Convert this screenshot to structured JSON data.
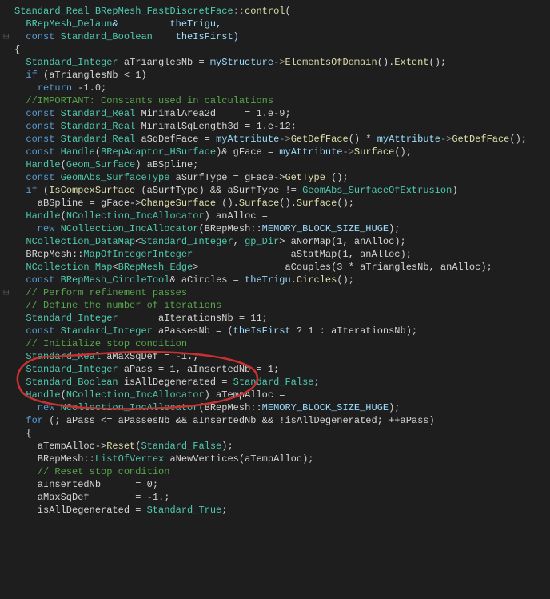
{
  "code": {
    "l01a": "Standard_Real",
    "l01b": " ",
    "l01c": "BRepMesh_FastDiscretFace",
    "l01d": "::",
    "l01e": "control",
    "l01f": "(",
    "l02a": "  ",
    "l02b": "BRepMesh_Delaun",
    "l02c": "&         theTrigu,",
    "l03a": "  ",
    "l03b": "const",
    "l03c": " ",
    "l03d": "Standard_Boolean",
    "l03e": "    theIsFirst)",
    "l04": "{",
    "l05a": "  ",
    "l05b": "Standard_Integer",
    "l05c": " aTrianglesNb = ",
    "l05d": "myStructure",
    "l05e": "->",
    "l05f": "ElementsOfDomain",
    "l05g": "().",
    "l05h": "Extent",
    "l05i": "();",
    "l06a": "  ",
    "l06b": "if",
    "l06c": " (aTrianglesNb < 1)",
    "l07a": "    ",
    "l07b": "return",
    "l07c": " -1.0;",
    "l08": "",
    "l09a": "  ",
    "l09b": "//IMPORTANT: Constants used in calculations",
    "l10a": "  ",
    "l10b": "const",
    "l10c": " ",
    "l10d": "Standard_Real",
    "l10e": " MinimalArea2d     = 1.e-9;",
    "l11a": "  ",
    "l11b": "const",
    "l11c": " ",
    "l11d": "Standard_Real",
    "l11e": " MinimalSqLength3d = 1.e-12;",
    "l12a": "  ",
    "l12b": "const",
    "l12c": " ",
    "l12d": "Standard_Real",
    "l12e": " aSqDefFace = ",
    "l12f": "myAttribute",
    "l12g": "->",
    "l12h": "GetDefFace",
    "l12i": "() * ",
    "l12j": "myAttribute",
    "l12k": "->",
    "l12l": "GetDefFace",
    "l12m": "();",
    "l13": "",
    "l14a": "  ",
    "l14b": "const",
    "l14c": " ",
    "l14d": "Handle",
    "l14e": "(",
    "l14f": "BRepAdaptor_HSurface",
    "l14g": ")& gFace = ",
    "l14h": "myAttribute",
    "l14i": "->",
    "l14j": "Surface",
    "l14k": "();",
    "l15": "",
    "l16a": "  ",
    "l16b": "Handle",
    "l16c": "(",
    "l16d": "Geom_Surface",
    "l16e": ") aBSpline;",
    "l17a": "  ",
    "l17b": "const",
    "l17c": " ",
    "l17d": "GeomAbs_SurfaceType",
    "l17e": " aSurfType = gFace->",
    "l17f": "GetType",
    "l17g": " ();",
    "l18a": "  ",
    "l18b": "if",
    "l18c": " (",
    "l18d": "IsCompexSurface",
    "l18e": " (aSurfType) && aSurfType != ",
    "l18f": "GeomAbs_SurfaceOfExtrusion",
    "l18g": ")",
    "l19a": "    aBSpline = gFace->",
    "l19b": "ChangeSurface",
    "l19c": " ().",
    "l19d": "Surface",
    "l19e": "().",
    "l19f": "Surface",
    "l19g": "();",
    "l20": "",
    "l21a": "  ",
    "l21b": "Handle",
    "l21c": "(",
    "l21d": "NCollection_IncAllocator",
    "l21e": ") anAlloc =",
    "l22a": "    ",
    "l22b": "new",
    "l22c": " ",
    "l22d": "NCollection_IncAllocator",
    "l22e": "(BRepMesh::",
    "l22f": "MEMORY_BLOCK_SIZE_HUGE",
    "l22g": ");",
    "l23a": "  ",
    "l23b": "NCollection_DataMap",
    "l23c": "<",
    "l23d": "Standard_Integer",
    "l23e": ", ",
    "l23f": "gp_Dir",
    "l23g": "> aNorMap(1, anAlloc);",
    "l24a": "  BRepMesh::",
    "l24b": "MapOfIntegerInteger",
    "l24c": "                 aStatMap(1, anAlloc);",
    "l25a": "  ",
    "l25b": "NCollection_Map",
    "l25c": "<",
    "l25d": "BRepMesh_Edge",
    "l25e": ">               aCouples(3 * aTrianglesNb, anAlloc);",
    "l26a": "  ",
    "l26b": "const",
    "l26c": " ",
    "l26d": "BRepMesh_CircleTool",
    "l26e": "& aCircles = ",
    "l26f": "theTrigu",
    "l26g": ".",
    "l26h": "Circles",
    "l26i": "();",
    "l27": "",
    "l28a": "  ",
    "l28b": "// Perform refinement passes",
    "l29a": "  ",
    "l29b": "// Define the number of iterations",
    "l30a": "  ",
    "l30b": "Standard_Integer",
    "l30c": "       aIterationsNb = 11;",
    "l31a": "  ",
    "l31b": "const",
    "l31c": " ",
    "l31d": "Standard_Integer",
    "l31e": " aPassesNb = (",
    "l31f": "theIsFirst",
    "l31g": " ? 1 : aIterationsNb);",
    "l32a": "  ",
    "l32b": "// Initialize stop condition",
    "l33a": "  ",
    "l33b": "Standard_Real",
    "l33c": " aMaxSqDef = -1.;",
    "l34a": "  ",
    "l34b": "Standard_Integer",
    "l34c": " aPass = 1, aInsertedNb = 1;",
    "l35a": "  ",
    "l35b": "Standard_Boolean",
    "l35c": " isAllDegenerated = ",
    "l35d": "Standard_False",
    "l35e": ";",
    "l36a": "  ",
    "l36b": "Handle",
    "l36c": "(",
    "l36d": "NCollection_IncAllocator",
    "l36e": ") aTempAlloc =",
    "l37a": "    ",
    "l37b": "new",
    "l37c": " ",
    "l37d": "NCollection_IncAllocator",
    "l37e": "(BRepMesh::",
    "l37f": "MEMORY_BLOCK_SIZE_HUGE",
    "l37g": ");",
    "l38a": "  ",
    "l38b": "for",
    "l38c": " (; aPass <= aPassesNb && aInsertedNb && !isAllDegenerated; ++aPass)",
    "l39": "  {",
    "l40a": "    aTempAlloc->",
    "l40b": "Reset",
    "l40c": "(",
    "l40d": "Standard_False",
    "l40e": ");",
    "l41a": "    BRepMesh::",
    "l41b": "ListOfVertex",
    "l41c": " aNewVertices(aTempAlloc);",
    "l42": "",
    "l43a": "    ",
    "l43b": "// Reset stop condition",
    "l44": "    aInsertedNb      = 0;",
    "l45": "    aMaxSqDef        = -1.;",
    "l46a": "    isAllDegenerated = ",
    "l46b": "Standard_True",
    "l46c": ";"
  },
  "gutter": {
    "minus": "⊟"
  }
}
